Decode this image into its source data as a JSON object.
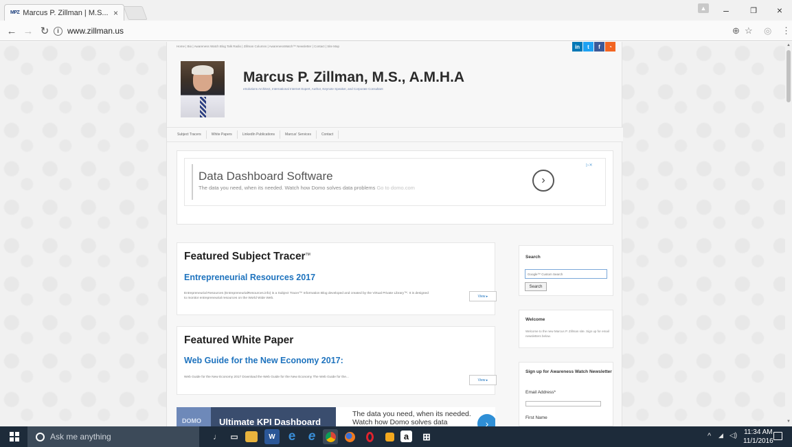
{
  "browser": {
    "tab_title": "Marcus P. Zillman | M.S...",
    "tab_close": "×",
    "favicon_text": "MPZ",
    "url": "www.zillman.us",
    "window_controls": {
      "minimize": "–",
      "maximize": "❐",
      "close": "×"
    }
  },
  "site": {
    "topnav": "Home | Bio | Awareness Watch Blog Talk Radio | Zillman Columns | AwarenessWatch™ Newsletter | Contact | Site Map",
    "social": [
      "in",
      "t",
      "f",
      "rss"
    ],
    "title": "Marcus P. Zillman, M.S., A.M.H.A",
    "tagline": "eSolutions Architect, International Internet Expert, Author, Keynote Speaker, and Corporate Consultant",
    "menu": [
      "Subject Tracers",
      "White Papers",
      "LinkedIn Publications",
      "Marcus' Services",
      "Contact"
    ]
  },
  "ad_top": {
    "headline": "Data Dashboard Software",
    "body": "The data you need, when its needed. Watch how Domo solves data problems",
    "link": "Go to domo.com",
    "arrow": "›"
  },
  "featured_tracer": {
    "heading": "Featured Subject Tracer",
    "tm": "TM",
    "link": "Entrepreneurial Resources 2017",
    "text": "Entrepreneurial Resources (EntrepreneurialResources.info) is a Subject Tracer™ Information Blog developed and created by the Virtual Private Library™. It is designed to monitor entrepreneurial resources on the World Wide Web.",
    "view": "View ▸"
  },
  "featured_paper": {
    "heading": "Featured White Paper",
    "link": "Web Guide for the New Economy 2017:",
    "text": "Web Guide for the New Economy 2017 Download the Web Guide for the New Economy The Web Guide for the...",
    "view": "View ▸"
  },
  "ad_bottom": {
    "brand": "DOMO",
    "image_text": "Ultimate KPI Dashboard",
    "text_line1": "The data you need, when its needed.",
    "text_line2": "Watch how Domo solves data",
    "arrow": "›"
  },
  "sidebar": {
    "search_heading": "Search",
    "search_placeholder": "Google™ Custom Search",
    "search_button": "Search",
    "welcome_heading": "Welcome",
    "welcome_text": "Welcome to the new Marcus P. Zillman site. Sign up for email newsletters below.",
    "signup_heading": "Sign up for Awareness Watch Newsletter",
    "email_label": "Email Address*",
    "first_name_label": "First Name"
  },
  "taskbar": {
    "search_text": "Ask me anything",
    "time": "11:34 AM",
    "date": "11/1/2016"
  },
  "colors": {
    "link_blue": "#1e73be",
    "taskbar": "#1d2b3a",
    "linkedin": "#0077b5",
    "twitter": "#1da1f2",
    "facebook": "#3b5998",
    "rss": "#f26522"
  }
}
